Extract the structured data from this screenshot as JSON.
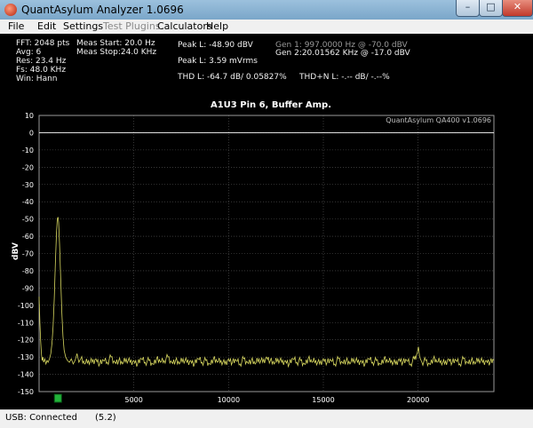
{
  "window": {
    "title": "QuantAsylum Analyzer 1.0696",
    "min": "–",
    "max": "□",
    "close": "✕"
  },
  "menu": [
    {
      "label": "File",
      "enabled": true
    },
    {
      "label": "Edit",
      "enabled": true
    },
    {
      "label": "Settings",
      "enabled": true
    },
    {
      "label": "Test Plugins",
      "enabled": false
    },
    {
      "label": "Calculators",
      "enabled": true
    },
    {
      "label": "Help",
      "enabled": true
    }
  ],
  "info": {
    "fft": "FFT: 2048 pts",
    "avg": "Avg: 6",
    "res": "Res: 23.4 Hz",
    "fs": "Fs: 48.0 KHz",
    "win": "Win: Hann",
    "meas_start": "Meas Start: 20.0 Hz",
    "meas_stop": "Meas Stop:24.0 KHz",
    "peak_l_dbv": "Peak L: -48.90 dBV",
    "peak_l_mv": "Peak L: 3.59 mVrms",
    "thd_l": "THD L: -64.7 dB/ 0.05827%",
    "thdn_l": "THD+N L: -.-- dB/ -.--%",
    "gen1": "Gen 1: 997.0000 Hz @ -70.0  dBV",
    "gen2": "Gen 2:20.01562 KHz @ -17.0  dBV"
  },
  "status": {
    "connection": "USB: Connected",
    "version": "(5.2)"
  },
  "colors": {
    "trace": "#d8d860",
    "grid": "#5a5a5a",
    "marker": "#22b33a",
    "refline": "#ffffff"
  },
  "chart_data": {
    "type": "line",
    "title": "A1U3 Pin 6, Buffer Amp.",
    "watermark": "QuantAsylum QA400 v1.0696",
    "ylabel": "dBV",
    "xlabel": "",
    "xlim": [
      0,
      24000
    ],
    "ylim": [
      -150,
      10
    ],
    "x_ticks": [
      5000,
      10000,
      15000,
      20000
    ],
    "x_tick_labels": [
      "5000",
      "10000",
      "15000",
      "20000"
    ],
    "y_ticks": [
      10,
      0,
      -10,
      -20,
      -30,
      -40,
      -50,
      -60,
      -70,
      -80,
      -90,
      -100,
      -110,
      -120,
      -130,
      -140,
      -150
    ],
    "y_tick_labels": [
      "10",
      "0",
      "-10",
      "-20",
      "-30",
      "-40",
      "-50",
      "-60",
      "-70",
      "-80",
      "-90",
      "-100",
      "-110",
      "-120",
      "-130",
      "-140",
      "-150"
    ],
    "grid": true,
    "reference_level": 0,
    "series": [
      {
        "points": [
          [
            0,
            -95
          ],
          [
            40,
            -110
          ],
          [
            80,
            -120
          ],
          [
            120,
            -128
          ],
          [
            160,
            -132
          ],
          [
            200,
            -130
          ],
          [
            240,
            -133
          ],
          [
            300,
            -131
          ],
          [
            360,
            -134
          ],
          [
            420,
            -132
          ],
          [
            480,
            -133
          ],
          [
            550,
            -131
          ],
          [
            620,
            -128
          ],
          [
            680,
            -122
          ],
          [
            740,
            -112
          ],
          [
            800,
            -96
          ],
          [
            860,
            -76
          ],
          [
            920,
            -58
          ],
          [
            960,
            -50
          ],
          [
            997,
            -48.9
          ],
          [
            1030,
            -52
          ],
          [
            1080,
            -64
          ],
          [
            1140,
            -84
          ],
          [
            1200,
            -104
          ],
          [
            1260,
            -118
          ],
          [
            1320,
            -126
          ],
          [
            1400,
            -130
          ],
          [
            1500,
            -132
          ],
          [
            1600,
            -133
          ],
          [
            1700,
            -131
          ],
          [
            1800,
            -134
          ],
          [
            1900,
            -132
          ],
          [
            2000,
            -128
          ],
          [
            2100,
            -133
          ],
          [
            2200,
            -131
          ],
          [
            2400,
            -134
          ],
          [
            2600,
            -132
          ],
          [
            2800,
            -133
          ],
          [
            3000,
            -131
          ],
          [
            3200,
            -134
          ],
          [
            3400,
            -132
          ],
          [
            3600,
            -133
          ],
          [
            3800,
            -130
          ],
          [
            4000,
            -133
          ],
          [
            4200,
            -132
          ],
          [
            4400,
            -134
          ],
          [
            4600,
            -131
          ],
          [
            4800,
            -133
          ],
          [
            5000,
            -132
          ],
          [
            5200,
            -134
          ],
          [
            5400,
            -131
          ],
          [
            5600,
            -133
          ],
          [
            5800,
            -132
          ],
          [
            6000,
            -134
          ],
          [
            6200,
            -131
          ],
          [
            6400,
            -133
          ],
          [
            6600,
            -132
          ],
          [
            6800,
            -130
          ],
          [
            7000,
            -133
          ],
          [
            7200,
            -132
          ],
          [
            7400,
            -134
          ],
          [
            7600,
            -131
          ],
          [
            7800,
            -133
          ],
          [
            8000,
            -132
          ],
          [
            8200,
            -134
          ],
          [
            8400,
            -131
          ],
          [
            8600,
            -133
          ],
          [
            8800,
            -132
          ],
          [
            9000,
            -134
          ],
          [
            9200,
            -131
          ],
          [
            9400,
            -133
          ],
          [
            9600,
            -132
          ],
          [
            9800,
            -134
          ],
          [
            10000,
            -131
          ],
          [
            10200,
            -133
          ],
          [
            10400,
            -132
          ],
          [
            10600,
            -134
          ],
          [
            10800,
            -131
          ],
          [
            11000,
            -133
          ],
          [
            11200,
            -132
          ],
          [
            11400,
            -134
          ],
          [
            11600,
            -131
          ],
          [
            11800,
            -133
          ],
          [
            12000,
            -130
          ],
          [
            12200,
            -132
          ],
          [
            12400,
            -134
          ],
          [
            12600,
            -131
          ],
          [
            12800,
            -133
          ],
          [
            13000,
            -132
          ],
          [
            13200,
            -134
          ],
          [
            13400,
            -131
          ],
          [
            13600,
            -133
          ],
          [
            13800,
            -132
          ],
          [
            14000,
            -134
          ],
          [
            14200,
            -131
          ],
          [
            14400,
            -133
          ],
          [
            14600,
            -132
          ],
          [
            14800,
            -134
          ],
          [
            15000,
            -131
          ],
          [
            15200,
            -133
          ],
          [
            15400,
            -132
          ],
          [
            15600,
            -134
          ],
          [
            15800,
            -131
          ],
          [
            16000,
            -133
          ],
          [
            16200,
            -132
          ],
          [
            16400,
            -134
          ],
          [
            16600,
            -131
          ],
          [
            16800,
            -133
          ],
          [
            17000,
            -132
          ],
          [
            17200,
            -134
          ],
          [
            17400,
            -131
          ],
          [
            17600,
            -133
          ],
          [
            17800,
            -132
          ],
          [
            18000,
            -134
          ],
          [
            18200,
            -131
          ],
          [
            18400,
            -133
          ],
          [
            18600,
            -132
          ],
          [
            18800,
            -134
          ],
          [
            19000,
            -131
          ],
          [
            19200,
            -133
          ],
          [
            19400,
            -132
          ],
          [
            19600,
            -134
          ],
          [
            19800,
            -131
          ],
          [
            19950,
            -128
          ],
          [
            20016,
            -124
          ],
          [
            20080,
            -130
          ],
          [
            20200,
            -133
          ],
          [
            20400,
            -132
          ],
          [
            20600,
            -134
          ],
          [
            20800,
            -131
          ],
          [
            21000,
            -133
          ],
          [
            21200,
            -132
          ],
          [
            21400,
            -134
          ],
          [
            21600,
            -131
          ],
          [
            21800,
            -133
          ],
          [
            22000,
            -132
          ],
          [
            22200,
            -134
          ],
          [
            22400,
            -131
          ],
          [
            22600,
            -133
          ],
          [
            22800,
            -132
          ],
          [
            23000,
            -134
          ],
          [
            23200,
            -131
          ],
          [
            23400,
            -133
          ],
          [
            23600,
            -132
          ],
          [
            23800,
            -133
          ],
          [
            24000,
            -132
          ]
        ]
      }
    ]
  }
}
